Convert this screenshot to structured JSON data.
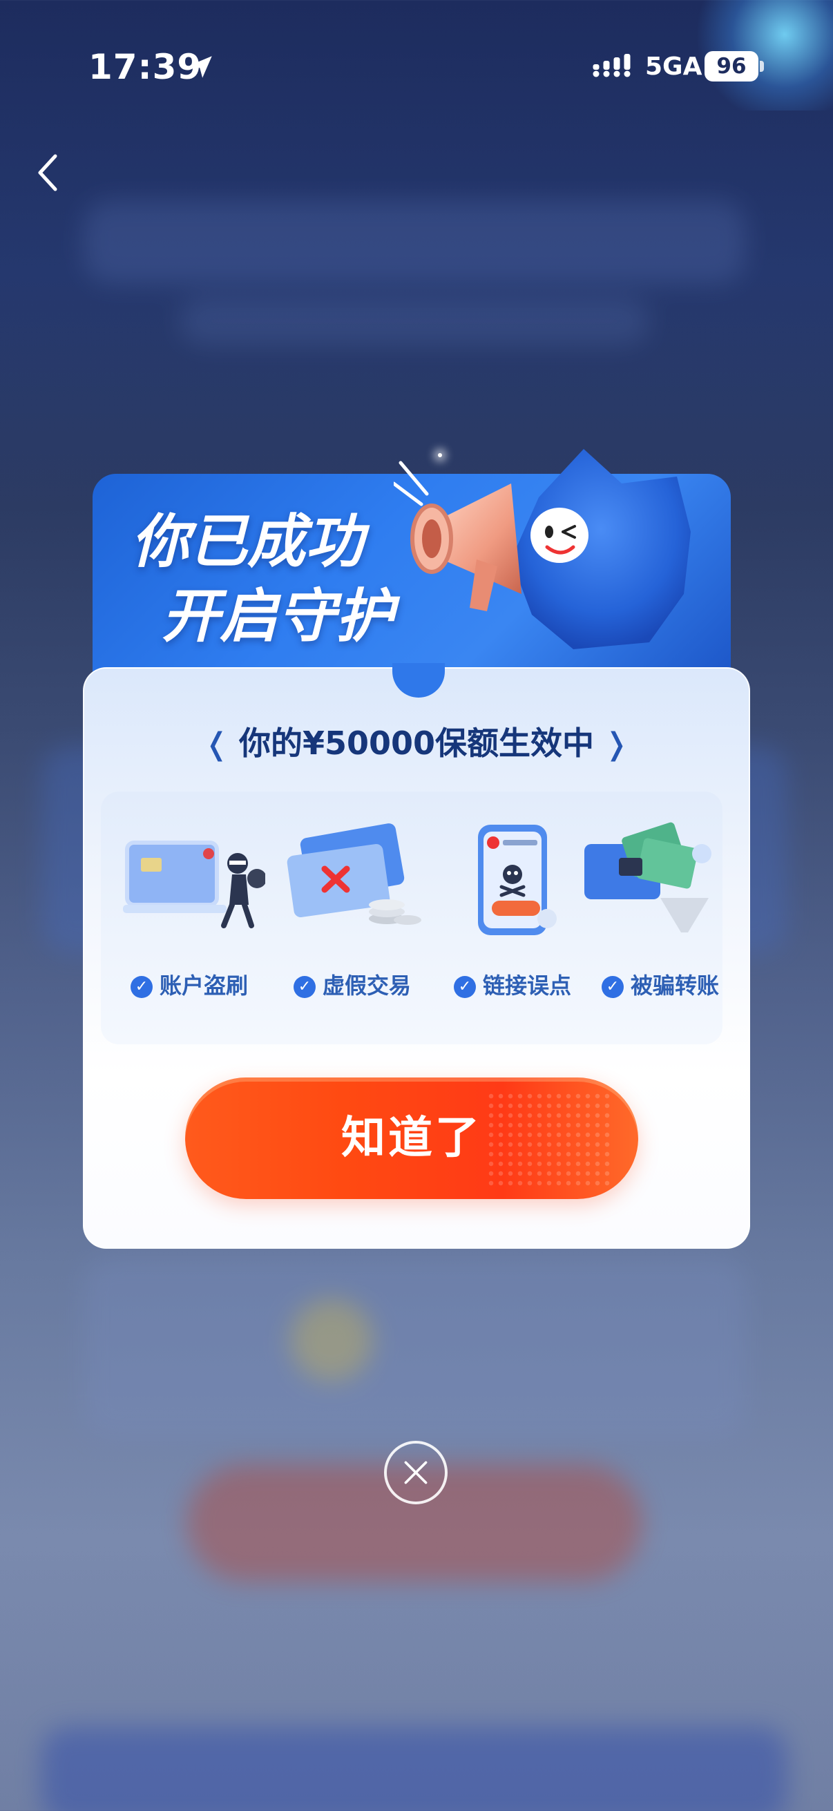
{
  "status_bar": {
    "time": "17:39",
    "network": "5GA",
    "battery": "96"
  },
  "dialog": {
    "title_line1": "你已成功",
    "title_line2": "开启守护",
    "coverage_text": "你的¥50000保额生效中",
    "risks": [
      {
        "label": "账户盗刷",
        "icon": "card-thief-icon"
      },
      {
        "label": "虚假交易",
        "icon": "fake-card-icon"
      },
      {
        "label": "链接误点",
        "icon": "phone-skull-icon"
      },
      {
        "label": "被骗转账",
        "icon": "fraud-money-icon"
      }
    ],
    "ok_label": "知道了"
  },
  "colors": {
    "header_blue": "#2f7df0",
    "button_orange": "#ff4a12",
    "label_blue": "#2d5fb4"
  }
}
